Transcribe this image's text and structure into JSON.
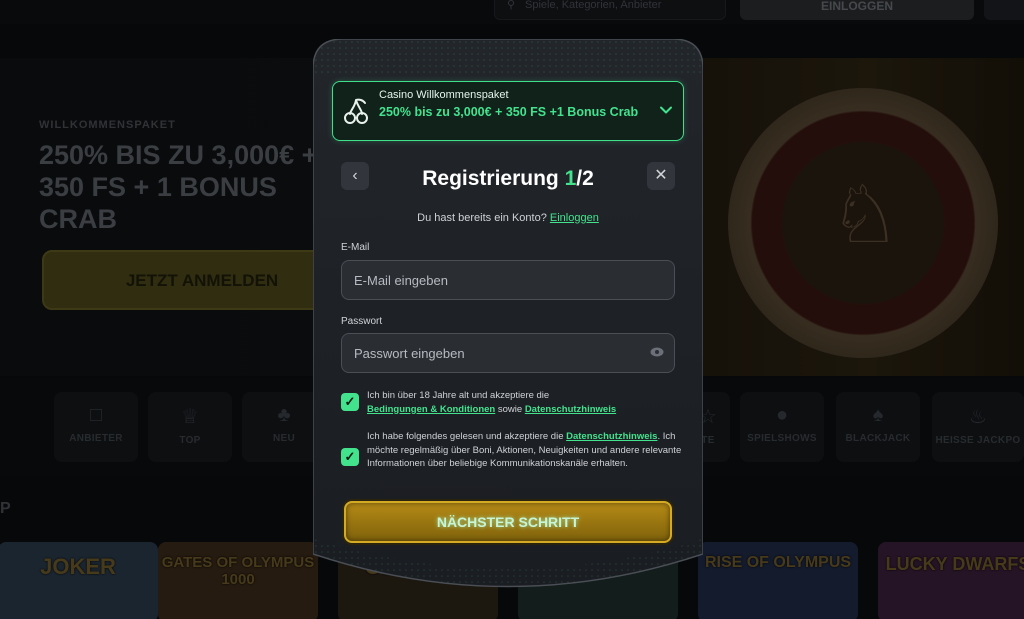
{
  "background": {
    "search_placeholder": "Spiele, Kategorien, Anbieter",
    "login_label": "EINLOGGEN",
    "hero": {
      "kicker": "WILLKOMMENSPAKET",
      "title": "250% BIS ZU 3,000€ + 350 FS + 1 BONUS CRAB",
      "cta": "JETZT ANMELDEN"
    },
    "categories": [
      {
        "label": "ANBIETER",
        "icon": "book-icon"
      },
      {
        "label": "TOP",
        "icon": "crown-icon"
      },
      {
        "label": "NEU",
        "icon": "clover-icon"
      },
      {
        "label": "TE",
        "icon": "star-icon"
      },
      {
        "label": "SPIELSHOWS",
        "icon": "microphone-icon"
      },
      {
        "label": "BLACKJACK",
        "icon": "spade-icon"
      },
      {
        "label": "HEISSE JACKPO",
        "icon": "flame-icon"
      }
    ],
    "section_title": "P",
    "games": [
      "JOKER",
      "GATES OF OLYMPUS 1000",
      "OLYMPUS",
      "GODS",
      "RISE OF OLYMPUS",
      "LUCKY DWARFS"
    ]
  },
  "modal": {
    "promo": {
      "subtitle": "Casino Willkommenspaket",
      "offer": "250% bis zu 3,000€ + 350 FS +1 Bonus Crab"
    },
    "title_prefix": "Registrierung ",
    "step_current": "1",
    "step_total": "/2",
    "have_account_text": "Du hast bereits ein Konto? ",
    "login_link": "Einloggen",
    "email": {
      "label": "E-Mail",
      "placeholder": "E-Mail eingeben",
      "value": ""
    },
    "password": {
      "label": "Passwort",
      "placeholder": "Passwort eingeben",
      "value": ""
    },
    "consent_terms": {
      "checked": true,
      "text_before": "Ich bin über 18 Jahre alt und akzeptiere die",
      "link_terms": "Bedingungen & Konditionen",
      "text_middle": " sowie ",
      "link_privacy": "Datenschutzhinweis"
    },
    "consent_marketing": {
      "checked": true,
      "text_before": "Ich habe folgendes gelesen und akzeptiere die ",
      "link_privacy": "Datenschutzhinweis",
      "text_after": ". Ich möchte regelmäßig über Boni, Aktionen, Neuigkeiten und andere relevante Informationen über beliebige Kommunikationskanäle erhalten."
    },
    "next_button": "NÄCHSTER SCHRITT"
  },
  "colors": {
    "accent_green": "#43e38e",
    "button_gold": "#b58a16",
    "modal_bg": "#1c1f24"
  }
}
